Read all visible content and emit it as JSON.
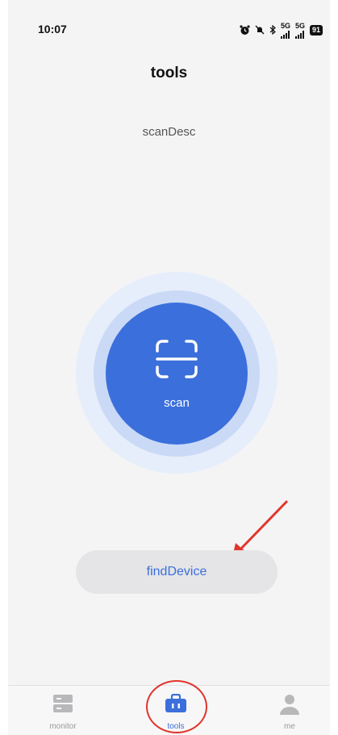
{
  "status_bar": {
    "time": "10:07",
    "battery": "91",
    "signal_1": "5G",
    "signal_2": "5G"
  },
  "header": {
    "title": "tools"
  },
  "main": {
    "scan_desc": "scanDesc",
    "scan_label": "scan",
    "find_device_label": "findDevice"
  },
  "tab_bar": {
    "items": [
      {
        "label": "monitor",
        "icon": "server-icon",
        "active": false
      },
      {
        "label": "tools",
        "icon": "toolbox-icon",
        "active": true
      },
      {
        "label": "me",
        "icon": "person-icon",
        "active": false
      }
    ]
  },
  "colors": {
    "accent": "#3b6fdb",
    "annotation": "#e0362c",
    "background": "#f4f4f5",
    "inactive_tab": "#9a9a9c"
  }
}
